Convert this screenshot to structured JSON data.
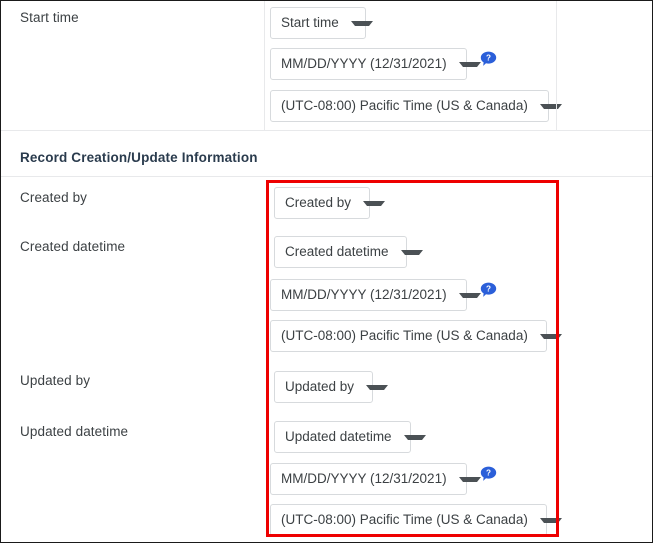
{
  "colors": {
    "highlight": "#ee0000",
    "label_text": "#3c4144",
    "section_heading": "#2a3b4d",
    "control_border": "#d7dadd",
    "divider": "#e8e9eb",
    "help_icon": "#2b5fd9"
  },
  "start_time_section": {
    "label": "Start time",
    "field_select": {
      "value": "Start time"
    },
    "format_select": {
      "value": "MM/DD/YYYY (12/31/2021)"
    },
    "timezone_select": {
      "value": "(UTC-08:00) Pacific Time (US & Canada)"
    },
    "help_icon": "help-question-bubble-icon"
  },
  "record_section": {
    "heading": "Record Creation/Update Information",
    "rows": [
      {
        "label": "Created by",
        "field_select": {
          "value": "Created by"
        }
      },
      {
        "label": "Created datetime",
        "field_select": {
          "value": "Created datetime"
        },
        "format_select": {
          "value": "MM/DD/YYYY (12/31/2021)"
        },
        "timezone_select": {
          "value": "(UTC-08:00) Pacific Time (US & Canada)"
        },
        "help_icon": "help-question-bubble-icon"
      },
      {
        "label": "Updated by",
        "field_select": {
          "value": "Updated by"
        }
      },
      {
        "label": "Updated datetime",
        "field_select": {
          "value": "Updated datetime"
        },
        "format_select": {
          "value": "MM/DD/YYYY (12/31/2021)"
        },
        "timezone_select": {
          "value": "(UTC-08:00) Pacific Time (US & Canada)"
        },
        "help_icon": "help-question-bubble-icon"
      }
    ]
  }
}
